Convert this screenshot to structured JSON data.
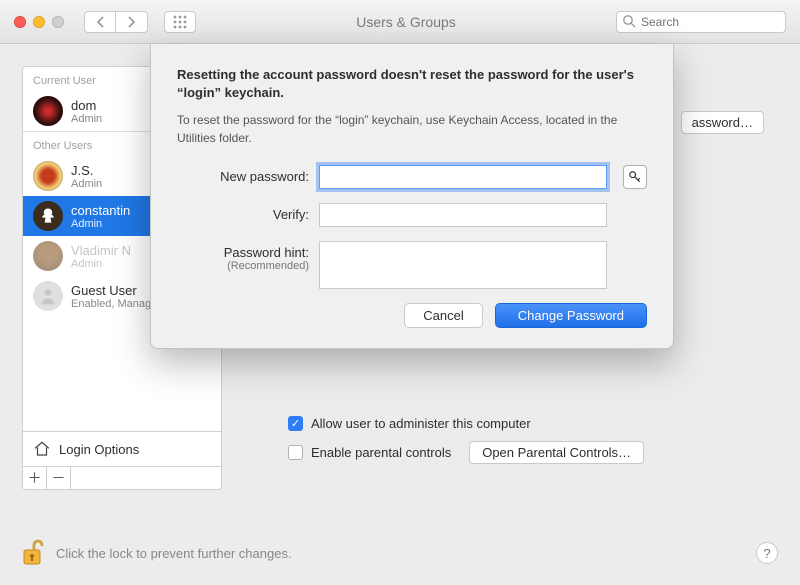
{
  "window": {
    "title": "Users & Groups",
    "search_placeholder": "Search"
  },
  "sidebar": {
    "current_label": "Current User",
    "other_label": "Other Users",
    "current": {
      "name": "dom",
      "role": "Admin"
    },
    "others": [
      {
        "name": "J.S.",
        "role": "Admin"
      },
      {
        "name": "constantin",
        "role": "Admin"
      },
      {
        "name": "Vladimir N",
        "role": "Admin"
      },
      {
        "name": "Guest User",
        "role": "Enabled, Managed"
      }
    ],
    "login_options": "Login Options"
  },
  "right": {
    "change_password_btn": "assword…",
    "allow_admin": "Allow user to administer this computer",
    "enable_parental": "Enable parental controls",
    "open_parental": "Open Parental Controls…"
  },
  "sheet": {
    "heading": "Resetting the account password doesn't reset the password for the user's “login” keychain.",
    "subtext": "To reset the password for the “login” keychain, use Keychain Access, located in the Utilities folder.",
    "labels": {
      "new_password": "New password:",
      "verify": "Verify:",
      "hint": "Password hint:",
      "hint_rec": "(Recommended)"
    },
    "buttons": {
      "cancel": "Cancel",
      "change": "Change Password"
    },
    "values": {
      "new_password": "",
      "verify": "",
      "hint": ""
    }
  },
  "footer": {
    "lock_text": "Click the lock to prevent further changes."
  }
}
